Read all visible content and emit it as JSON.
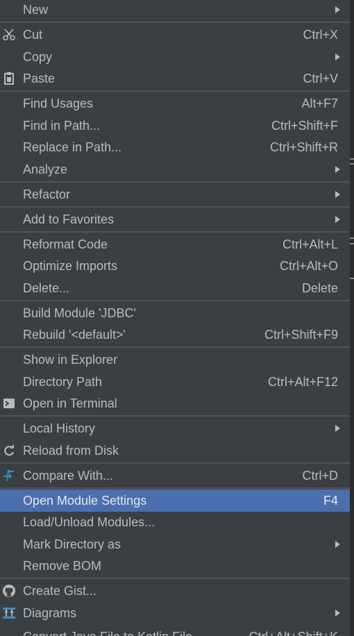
{
  "menu": {
    "new": {
      "label": "New"
    },
    "cut": {
      "label": "Cut",
      "shortcut": "Ctrl+X",
      "icon": "scissors-icon"
    },
    "copy": {
      "label": "Copy"
    },
    "paste": {
      "label": "Paste",
      "shortcut": "Ctrl+V",
      "icon": "clipboard-icon"
    },
    "find_usages": {
      "label": "Find Usages",
      "shortcut": "Alt+F7"
    },
    "find_in_path": {
      "label": "Find in Path...",
      "shortcut": "Ctrl+Shift+F"
    },
    "replace_in_path": {
      "label": "Replace in Path...",
      "shortcut": "Ctrl+Shift+R"
    },
    "analyze": {
      "label": "Analyze"
    },
    "refactor": {
      "label": "Refactor"
    },
    "add_to_favorites": {
      "label": "Add to Favorites"
    },
    "reformat_code": {
      "label": "Reformat Code",
      "shortcut": "Ctrl+Alt+L"
    },
    "optimize_imports": {
      "label": "Optimize Imports",
      "shortcut": "Ctrl+Alt+O"
    },
    "delete": {
      "label": "Delete...",
      "shortcut": "Delete"
    },
    "build_module": {
      "label": "Build Module 'JDBC'"
    },
    "rebuild": {
      "label": "Rebuild '<default>'",
      "shortcut": "Ctrl+Shift+F9"
    },
    "show_in_explorer": {
      "label": "Show in Explorer"
    },
    "directory_path": {
      "label": "Directory Path",
      "shortcut": "Ctrl+Alt+F12"
    },
    "open_in_terminal": {
      "label": "Open in Terminal",
      "icon": "terminal-icon"
    },
    "local_history": {
      "label": "Local History"
    },
    "reload_from_disk": {
      "label": "Reload from Disk",
      "icon": "reload-icon"
    },
    "compare_with": {
      "label": "Compare With...",
      "shortcut": "Ctrl+D",
      "icon": "compare-icon"
    },
    "open_module_settings": {
      "label": "Open Module Settings",
      "shortcut": "F4"
    },
    "load_unload_modules": {
      "label": "Load/Unload Modules..."
    },
    "mark_directory_as": {
      "label": "Mark Directory as"
    },
    "remove_bom": {
      "label": "Remove BOM"
    },
    "create_gist": {
      "label": "Create Gist...",
      "icon": "github-icon"
    },
    "diagrams": {
      "label": "Diagrams",
      "icon": "diagram-icon"
    },
    "convert_java": {
      "label": "Convert Java File to Kotlin File",
      "shortcut": "Ctrl+Alt+Shift+K"
    }
  },
  "colors": {
    "background": "#3c3f41",
    "text": "#bbbbbb",
    "selection": "#4b6eaf",
    "separator": "#515658"
  }
}
